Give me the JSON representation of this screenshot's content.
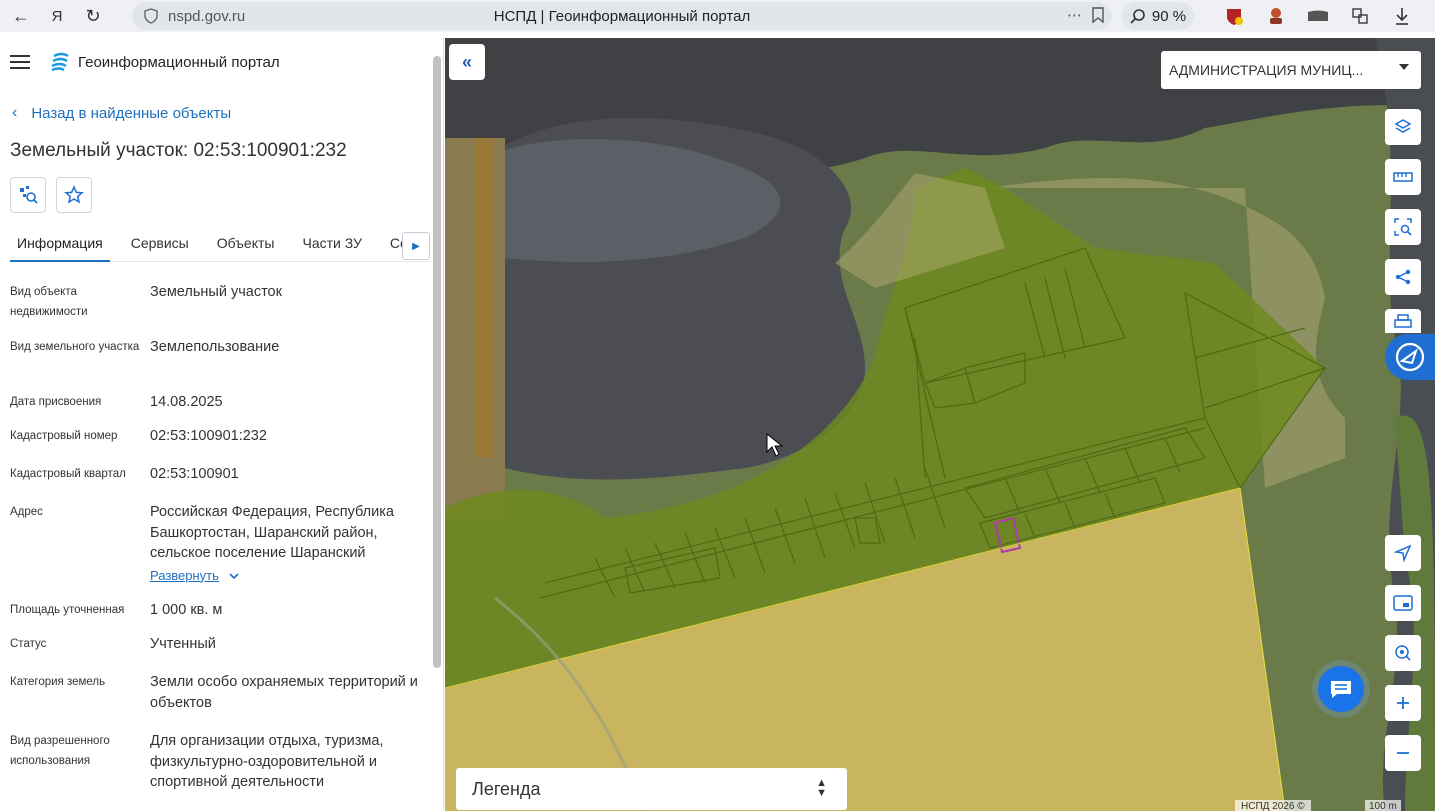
{
  "browser": {
    "url": "nspd.gov.ru",
    "tab_title": "НСПД | Геоинформационный портал",
    "zoom": "90 %"
  },
  "panel": {
    "portal_name": "Геоинформационный портал",
    "back_label": "Назад в найденные объекты",
    "object_title": "Земельный участок: 02:53:100901:232",
    "tabs": [
      {
        "label": "Информация",
        "active": true
      },
      {
        "label": "Сервисы"
      },
      {
        "label": "Объекты"
      },
      {
        "label": "Части ЗУ"
      },
      {
        "label": "Соста"
      }
    ],
    "properties": [
      {
        "label": "Вид объекта недвижимости",
        "value": "Земельный участок"
      },
      {
        "label": "Вид земельного участка",
        "value": "Землепользование"
      },
      {
        "label": "Дата присвоения",
        "value": "14.08.2025"
      },
      {
        "label": "Кадастровый номер",
        "value": "02:53:100901:232"
      },
      {
        "label": "Кадастровый квартал",
        "value": "02:53:100901"
      },
      {
        "label": "Адрес",
        "value": "Российская Федерация, Республика Башкортостан, Шаранский район, сельское поселение Шаранский"
      },
      {
        "label": "Площадь уточненная",
        "value": "1 000 кв. м"
      },
      {
        "label": "Статус",
        "value": "Учтенный"
      },
      {
        "label": "Категория земель",
        "value": "Земли особо охраняемых территорий и объектов"
      },
      {
        "label": "Вид разрешенного использования",
        "value": "Для организации отдыха, туризма, физкультурно-оздоровительной и спортивной деятельности"
      }
    ],
    "expand_label": "Развернуть"
  },
  "map": {
    "layer_select": "АДМИНИСТРАЦИЯ МУНИЦ...",
    "legend_label": "Легенда",
    "copyright": "НСПД 2026 ©",
    "scale": "100 m",
    "colors": {
      "parcel_fill": "#6e8a1e",
      "selected_parcel": "#b03aa8",
      "zone_fill": "#c9b560",
      "water": "#4a4d52",
      "accent": "#1f6fd2"
    }
  }
}
